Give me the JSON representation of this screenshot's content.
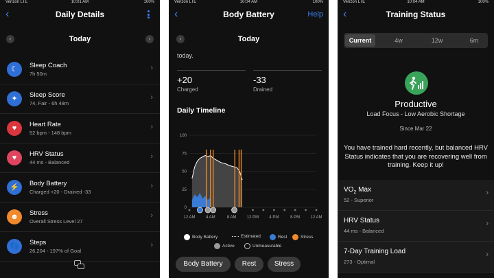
{
  "panel1": {
    "status": {
      "carrier": "Verizon  LTE",
      "time": "10:01 AM",
      "battery": "100%"
    },
    "title": "Daily Details",
    "date_label": "Today",
    "items": [
      {
        "title": "Sleep Coach",
        "sub": "7h 50m",
        "icon": "sleep-coach-icon",
        "color": "#2f6fd6",
        "glyph": "☾"
      },
      {
        "title": "Sleep Score",
        "sub": "74, Fair - 6h 48m",
        "icon": "sleep-score-icon",
        "color": "#2f6fd6",
        "glyph": "✦"
      },
      {
        "title": "Heart Rate",
        "sub": "52 bpm - 148 bpm",
        "icon": "heart-icon",
        "color": "#d9363e",
        "glyph": "♥"
      },
      {
        "title": "HRV Status",
        "sub": "44 ms - Balanced",
        "icon": "hrv-icon",
        "color": "#e0455f",
        "glyph": "♥"
      },
      {
        "title": "Body Battery",
        "sub": "Charged +20 - Drained -33",
        "icon": "body-battery-icon",
        "color": "#2f6fd6",
        "glyph": "⚡"
      },
      {
        "title": "Stress",
        "sub": "Overall Stress Level 27",
        "icon": "stress-icon",
        "color": "#f08a2c",
        "glyph": "☻"
      },
      {
        "title": "Steps",
        "sub": "26,204 - 197% of Goal",
        "icon": "steps-icon",
        "color": "#2f6fd6",
        "glyph": "👣"
      }
    ]
  },
  "panel2": {
    "status": {
      "carrier": "Verizon  LTE",
      "time": "10:04 AM",
      "battery": "100%"
    },
    "title": "Body Battery",
    "help": "Help",
    "date_label": "Today",
    "clipped_text": "today.",
    "charged": {
      "value": "+20",
      "label": "Charged"
    },
    "drained": {
      "value": "-33",
      "label": "Drained"
    },
    "timeline_title": "Daily Timeline",
    "legend": {
      "body_battery": "Body Battery",
      "estimated": "Estimated",
      "rest": "Rest",
      "stress": "Stress",
      "active": "Active",
      "unmeasurable": "Unmeasurable"
    },
    "colors": {
      "rest": "#3a7bd5",
      "stress": "#f08a2c",
      "active": "#9a9a9a",
      "body_battery": "#ffffff"
    },
    "pills": [
      "Body Battery",
      "Rest",
      "Stress"
    ]
  },
  "panel3": {
    "status": {
      "carrier": "Verizon  LTE",
      "time": "10:04 AM",
      "battery": "100%"
    },
    "title": "Training Status",
    "tabs": [
      "Current",
      "4w",
      "12w",
      "6m"
    ],
    "status_title": "Productive",
    "status_sub": "Load Focus - Low Aerobic Shortage",
    "since": "Since Mar 22",
    "message": "You have trained hard recently, but balanced HRV Status indicates that you are recovering well from training. Keep it up!",
    "rows": [
      {
        "title_main": "VO",
        "title_sub": "2",
        "title_tail": " Max",
        "sub": "52 - Superior"
      },
      {
        "title_main": "HRV Status",
        "title_sub": "",
        "title_tail": "",
        "sub": "44 ms - Balanced"
      },
      {
        "title_main": "7-Day Training Load",
        "title_sub": "",
        "title_tail": "",
        "sub": "273 - Optimal"
      }
    ]
  },
  "chart_data": {
    "type": "area",
    "title": "Daily Timeline",
    "xlabel": "",
    "ylabel": "",
    "ylim": [
      0,
      100
    ],
    "y_ticks": [
      0,
      25,
      50,
      75,
      100
    ],
    "x_tick_labels": [
      "12 AM",
      "4 AM",
      "8 AM",
      "12 PM",
      "4 PM",
      "8 PM",
      "12 AM"
    ],
    "xlim_hours": [
      0,
      24
    ],
    "grid": true,
    "series": [
      {
        "name": "Body Battery",
        "x": [
          0.5,
          1,
          1.5,
          2,
          2.5,
          3,
          3.5,
          4,
          4.5,
          5,
          5.5,
          6,
          6.5,
          7,
          7.5,
          8,
          8.5,
          9,
          9.5,
          10
        ],
        "y": [
          40,
          56,
          64,
          68,
          70,
          72,
          70,
          72,
          68,
          66,
          64,
          62,
          61,
          60,
          58,
          57,
          56,
          55,
          50,
          38
        ]
      },
      {
        "name": "Rest",
        "x": [
          0.5,
          1,
          1.5,
          2,
          2.5,
          3,
          3.5,
          4
        ],
        "y": [
          10,
          18,
          14,
          20,
          12,
          16,
          10,
          14
        ]
      }
    ],
    "stress_spikes_hours": [
      3.2,
      4.0,
      4.5,
      8.6,
      9.4,
      9.8
    ]
  }
}
